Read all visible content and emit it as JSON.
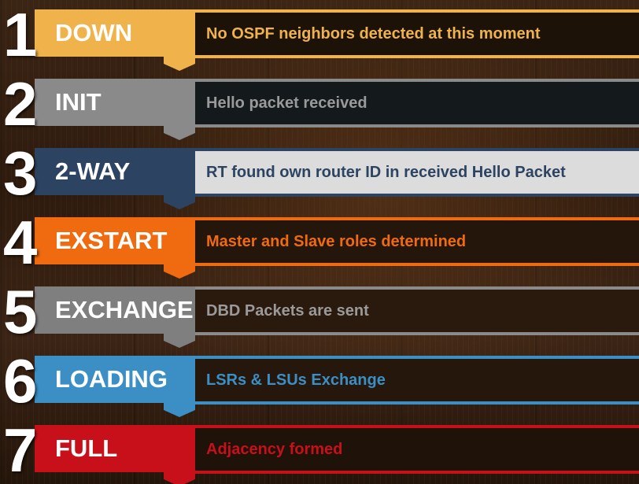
{
  "colors": {
    "down": "#f0b34b",
    "init": "#8a8a8a",
    "two_way": "#2c4462",
    "exstart": "#f06a0f",
    "exchange": "#7f7f7f",
    "loading": "#3b8fc4",
    "full": "#c8101a"
  },
  "stages": [
    {
      "number": "1",
      "name": "DOWN",
      "description": "No OSPF neighbors detected at this moment"
    },
    {
      "number": "2",
      "name": "INIT",
      "description": "Hello packet received"
    },
    {
      "number": "3",
      "name": "2-WAY",
      "description": "RT found own router ID in received Hello Packet"
    },
    {
      "number": "4",
      "name": "EXSTART",
      "description": "Master and Slave roles determined"
    },
    {
      "number": "5",
      "name": "EXCHANGE",
      "description": "DBD Packets are sent"
    },
    {
      "number": "6",
      "name": "LOADING",
      "description": "LSRs & LSUs Exchange"
    },
    {
      "number": "7",
      "name": "FULL",
      "description": "Adjacency formed"
    }
  ]
}
